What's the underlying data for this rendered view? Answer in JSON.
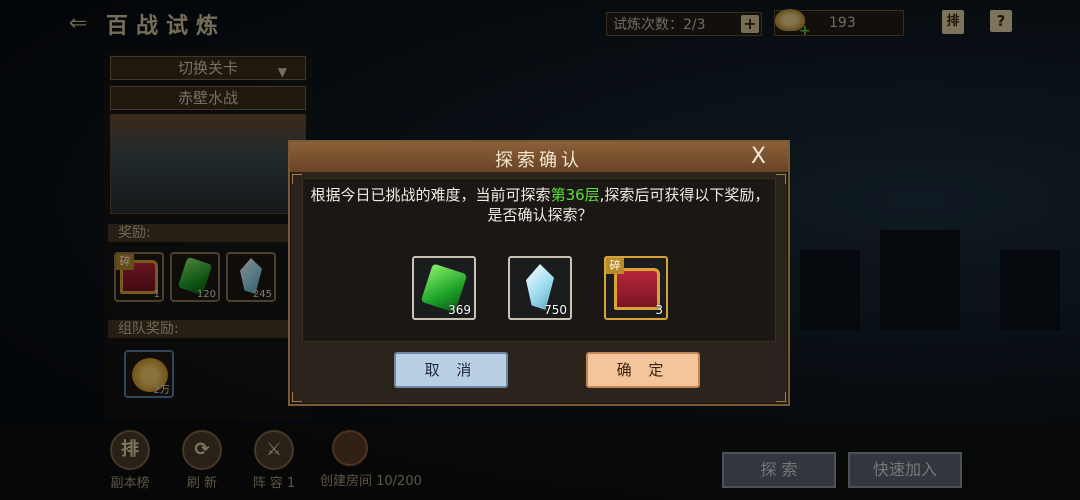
{
  "header": {
    "back_icon": "back-arrow-icon",
    "title": "百战试炼",
    "trial_label": "试炼次数：2/3",
    "trial_plus": "+",
    "gold_plus": "+",
    "gold_value": "193",
    "rank_label": "排",
    "help_label": "?"
  },
  "left_panel": {
    "switch_stage": "切换关卡",
    "stage_name": "赤壁水战",
    "rewards_label": "奖励:",
    "rewards": [
      {
        "icon": "chest-icon",
        "tag": "碎",
        "count": "1"
      },
      {
        "icon": "green-gem-icon",
        "count": "120"
      },
      {
        "icon": "crystal-icon",
        "count": "245"
      }
    ],
    "team_rewards_label": "组队奖励:",
    "team_reward": {
      "icon": "coin-icon",
      "count": "2万"
    }
  },
  "bottom_bar": {
    "ranking": {
      "icon": "排",
      "label": "副本榜"
    },
    "refresh": {
      "icon": "⟳",
      "label": "刷 新"
    },
    "lineup": {
      "icon": "⚔",
      "label": "阵 容 1"
    },
    "create_room": {
      "label": "创建房间 10/200"
    },
    "explore": "探 索",
    "quick_join": "快速加入"
  },
  "modal": {
    "title": "探索确认",
    "close": "X",
    "message_part1": "根据今日已挑战的难度，当前可探索",
    "message_highlight": "第36层",
    "message_part2": ",探索后可获得以下奖励，是否确认探索？",
    "items": [
      {
        "icon": "green-gem-icon",
        "count": "369"
      },
      {
        "icon": "crystal-icon",
        "count": "750"
      },
      {
        "icon": "chest-icon",
        "tag": "碎",
        "count": "3"
      }
    ],
    "cancel": "取 消",
    "confirm": "确 定"
  },
  "colors": {
    "highlight_green": "#5ee23a",
    "modal_header": "#8a6038",
    "cancel_button": "#b9cfe4",
    "confirm_button": "#f4c49a"
  }
}
